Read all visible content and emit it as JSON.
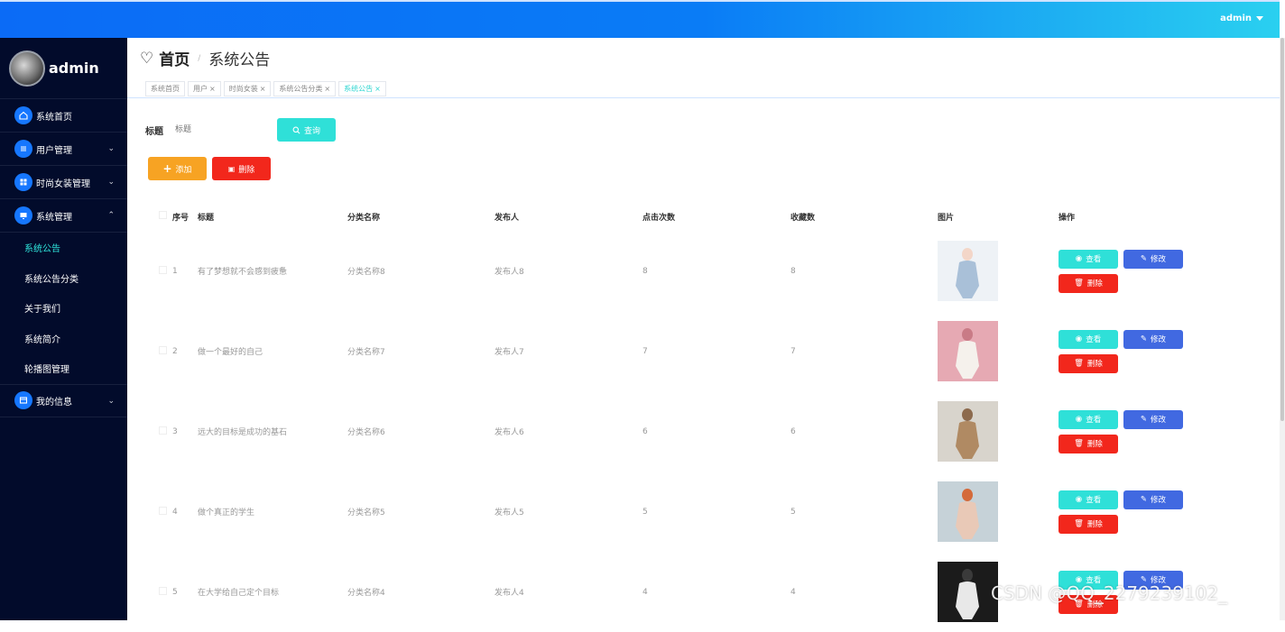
{
  "topbar": {
    "user": "admin"
  },
  "sidebar": {
    "username": "admin",
    "items": [
      {
        "label": "系统首页",
        "icon": "home-icon"
      },
      {
        "label": "用户管理",
        "icon": "list-icon"
      },
      {
        "label": "时尚女装管理",
        "icon": "grid-icon"
      },
      {
        "label": "系统管理",
        "icon": "monitor-icon"
      },
      {
        "label": "我的信息",
        "icon": "card-icon"
      }
    ],
    "sub_items": [
      "系统公告",
      "系统公告分类",
      "关于我们",
      "系统简介",
      "轮播图管理"
    ]
  },
  "breadcrumb": {
    "home": "首页",
    "current": "系统公告"
  },
  "tags": [
    "系统首页",
    "用户",
    "时尚女装",
    "系统公告分类",
    "系统公告"
  ],
  "search": {
    "label": "标题",
    "placeholder": "标题",
    "button": "查询"
  },
  "actions": {
    "add": "添加",
    "delete": "删除"
  },
  "table": {
    "headers": [
      "序号",
      "标题",
      "分类名称",
      "发布人",
      "点击次数",
      "收藏数",
      "图片",
      "操作"
    ],
    "rows": [
      {
        "no": "1",
        "title": "有了梦想就不会感到疲惫",
        "category": "分类名称8",
        "publisher": "发布人8",
        "clicks": "8",
        "favorites": "8",
        "image_colors": [
          "#eef2f6",
          "#a9c0d8",
          "#f3d6c8"
        ]
      },
      {
        "no": "2",
        "title": "做一个最好的自己",
        "category": "分类名称7",
        "publisher": "发布人7",
        "clicks": "7",
        "favorites": "7",
        "image_colors": [
          "#e6a9b3",
          "#f5f1ec",
          "#c97b86"
        ]
      },
      {
        "no": "3",
        "title": "远大的目标是成功的基石",
        "category": "分类名称6",
        "publisher": "发布人6",
        "clicks": "6",
        "favorites": "6",
        "image_colors": [
          "#d8d4cc",
          "#b08a63",
          "#8c6a4d"
        ]
      },
      {
        "no": "4",
        "title": "做个真正的学生",
        "category": "分类名称5",
        "publisher": "发布人5",
        "clicks": "5",
        "favorites": "5",
        "image_colors": [
          "#c6d2d8",
          "#e9c9b7",
          "#d46a3a"
        ]
      },
      {
        "no": "5",
        "title": "在大学给自己定个目标",
        "category": "分类名称4",
        "publisher": "发布人4",
        "clicks": "4",
        "favorites": "4",
        "image_colors": [
          "#1b1b1b",
          "#e8e8e8",
          "#3a3a3a"
        ]
      }
    ],
    "ops": {
      "view": "查看",
      "edit": "修改",
      "delete": "删除"
    }
  },
  "watermark": "CSDN @QQ_2279239102_",
  "colors": {
    "topbar_start": "#0b6bf6",
    "topbar_end": "#2ad0f0",
    "sidebar": "#020b2b",
    "accent_teal": "#2fe0d8",
    "accent_orange": "#f7a323",
    "accent_red": "#f2271c",
    "accent_blue": "#4169e1"
  }
}
